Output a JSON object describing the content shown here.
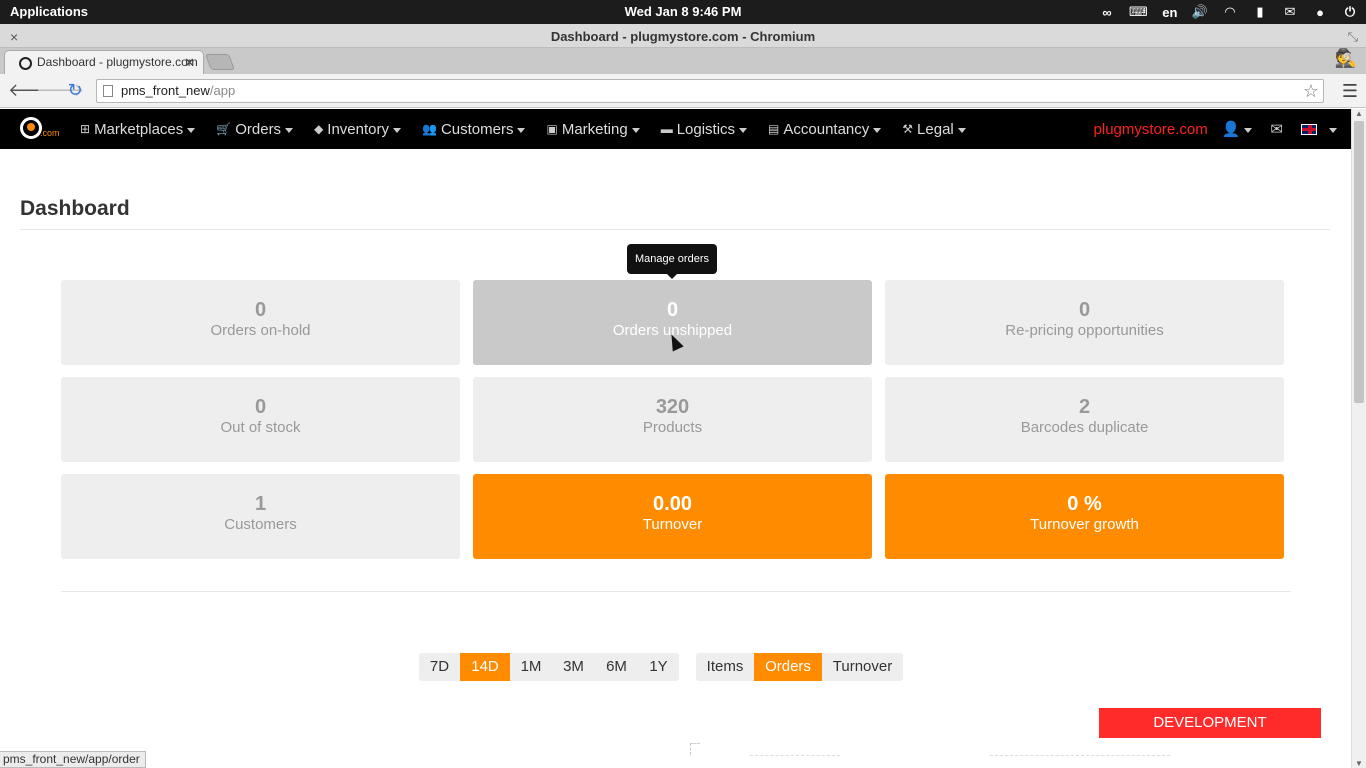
{
  "os": {
    "applications": "Applications",
    "datetime": "Wed Jan  8  9:46 PM",
    "lang": "en"
  },
  "window": {
    "title": "Dashboard - plugmystore.com - Chromium"
  },
  "browser": {
    "tab_title": "Dashboard - plugmystore.com",
    "url_host": "pms_front_new",
    "url_path": "/app",
    "status_url": "pms_front_new/app/order"
  },
  "navbar": {
    "items": [
      {
        "label": "Marketplaces",
        "icon": "sitemap-icon"
      },
      {
        "label": "Orders",
        "icon": "cart-icon"
      },
      {
        "label": "Inventory",
        "icon": "tag-icon"
      },
      {
        "label": "Customers",
        "icon": "users-icon"
      },
      {
        "label": "Marketing",
        "icon": "briefcase-icon"
      },
      {
        "label": "Logistics",
        "icon": "truck-icon"
      },
      {
        "label": "Accountancy",
        "icon": "book-icon"
      },
      {
        "label": "Legal",
        "icon": "gavel-icon"
      }
    ],
    "store_name": "plugmystore.com",
    "brand_suffix": ".com"
  },
  "dashboard": {
    "title": "Dashboard",
    "tooltip": "Manage orders",
    "tiles": [
      {
        "value": "0",
        "label": "Orders on-hold"
      },
      {
        "value": "0",
        "label": "Orders unshipped"
      },
      {
        "value": "0",
        "label": "Re-pricing opportunities"
      },
      {
        "value": "0",
        "label": "Out of stock"
      },
      {
        "value": "320",
        "label": "Products"
      },
      {
        "value": "2",
        "label": "Barcodes duplicate"
      },
      {
        "value": "1",
        "label": "Customers"
      },
      {
        "value": "0.00",
        "label": "Turnover"
      },
      {
        "value": "0 %",
        "label": "Turnover growth"
      }
    ],
    "period_buttons": [
      "7D",
      "14D",
      "1M",
      "3M",
      "6M",
      "1Y"
    ],
    "active_period": "14D",
    "metric_buttons": [
      "Items",
      "Orders",
      "Turnover"
    ],
    "active_metric": "Orders",
    "dev_badge": "DEVELOPMENT ENVIRONMENT"
  },
  "colors": {
    "accent": "#ff8c00",
    "danger": "#ff2a2a",
    "tile_bg": "#eeeeee",
    "tile_hover": "#c9c9c9"
  }
}
